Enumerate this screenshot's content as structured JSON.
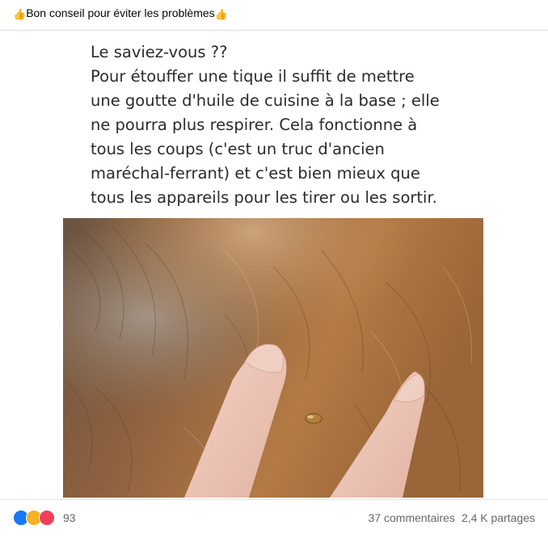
{
  "post": {
    "caption": "Bon conseil pour éviter les problèmes",
    "caption_emoji": "thumbs-up",
    "image_text": {
      "lines": [
        "Le saviez-vous ??",
        "Pour étouffer une tique il suffit de mettre",
        "une goutte d'huile de cuisine à la base ; elle",
        "ne pourra plus respirer. Cela fonctionne à",
        "tous les coups (c'est un truc d'ancien",
        "maréchal-ferrant) et c'est bien mieux que",
        "tous les appareils pour les tirer ou les sortir."
      ]
    }
  },
  "reactions": {
    "count": "93",
    "types": [
      "like-icon",
      "wow-icon",
      "love-icon"
    ]
  },
  "stats": {
    "comments": "37 commentaires",
    "shares": "2,4 K partages"
  },
  "colors": {
    "like": "#1877f2",
    "wow": "#f7b125",
    "love": "#f33e58",
    "secondary_text": "#65676b"
  }
}
